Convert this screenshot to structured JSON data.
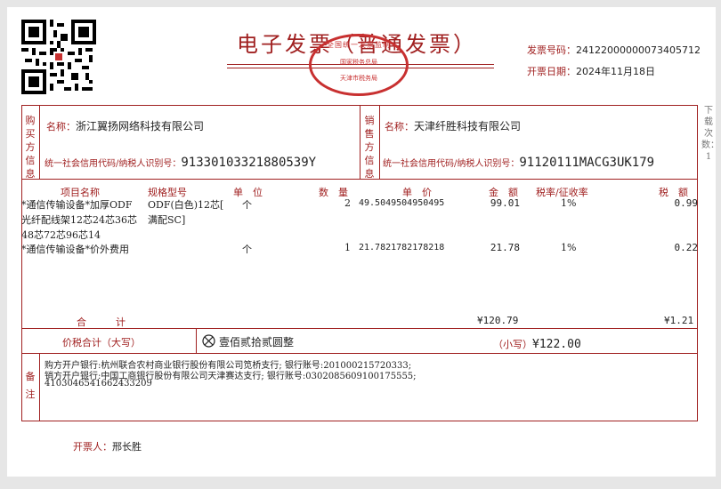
{
  "invoice": {
    "title": "电子发票（普通发票）",
    "seal": {
      "top": "全国统一发票监制",
      "middle": "国家税务总局",
      "bottom": "天津市税务局"
    },
    "number_label": "发票号码：",
    "number": "24122000000073405712",
    "date_label": "开票日期：",
    "date": "2024年11月18日",
    "side_note": "下载次数：1"
  },
  "buyer": {
    "section_label": "购买方信息",
    "name_label": "名称：",
    "name": "浙江翼扬网络科技有限公司",
    "tax_label": "统一社会信用代码/纳税人识别号：",
    "tax_id": "91330103321880539Y"
  },
  "seller": {
    "section_label": "销售方信息",
    "name_label": "名称：",
    "name": "天津纤胜科技有限公司",
    "tax_label": "统一社会信用代码/纳税人识别号：",
    "tax_id": "91120111MACG3UK179"
  },
  "items_header": {
    "name": "项目名称",
    "spec": "规格型号",
    "unit": "单　位",
    "qty": "数　量",
    "price": "单　价",
    "amount": "金　额",
    "rate": "税率/征收率",
    "tax": "税　额"
  },
  "items": [
    {
      "name_lines": [
        "*通信传输设备*加厚ODF",
        "光纤配线架12芯24芯36芯",
        "48芯72芯96芯14"
      ],
      "spec_lines": [
        "ODF(白色)12芯[",
        "满配SC]"
      ],
      "unit": "个",
      "qty": "2",
      "price": "49.5049504950495",
      "amount": "99.01",
      "rate": "1%",
      "tax": "0.99"
    },
    {
      "name_lines": [
        "*通信传输设备*价外费用"
      ],
      "spec_lines": [],
      "unit": "个",
      "qty": "1",
      "price": "21.7821782178218",
      "amount": "21.78",
      "rate": "1%",
      "tax": "0.22"
    }
  ],
  "totals": {
    "label": "合　　　计",
    "amount": "¥120.79",
    "tax": "¥1.21",
    "in_words_label": "价税合计（大写）",
    "in_words": "壹佰贰拾贰圆整",
    "small_label": "（小写）",
    "small": "¥122.00"
  },
  "remarks": {
    "label": "备注",
    "lines": [
      "购方开户银行:杭州联合农村商业银行股份有限公司笕桥支行;      银行账号:201000215720333;",
      "销方开户银行:中国工商银行股份有限公司天津赛达支行;      银行账号:0302085609100175555;",
      "4103046541662433209"
    ]
  },
  "issuer": {
    "label": "开票人：",
    "name": "邢长胜"
  },
  "colors": {
    "accent": "#a02020",
    "seal": "#c83030"
  },
  "icons": {
    "qr": "qr-code-icon",
    "cross_circle": "cross-circle-icon"
  }
}
